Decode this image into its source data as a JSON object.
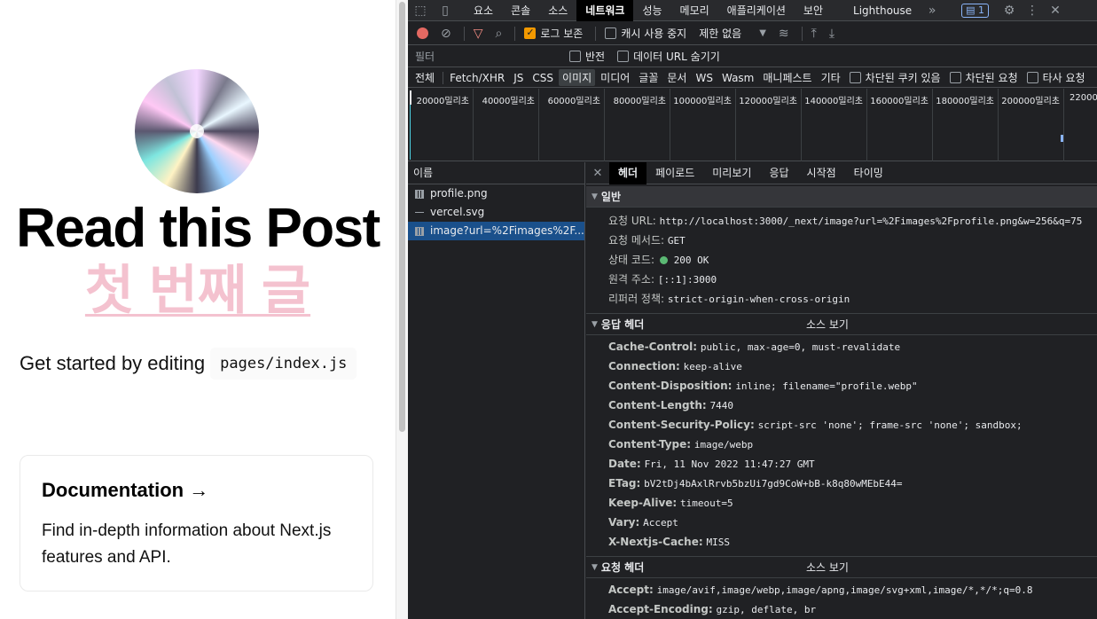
{
  "page": {
    "title": "Read this Post",
    "link": "첫 번째 글",
    "description": "Get started by editing",
    "code": "pages/index.js",
    "card": {
      "title": "Documentation →",
      "text": "Find in-depth information about Next.js features and API."
    }
  },
  "devtools": {
    "tabs": [
      "요소",
      "콘솔",
      "소스",
      "네트워크",
      "성능",
      "메모리",
      "애플리케이션",
      "보안",
      "Lighthouse"
    ],
    "active_tab": "네트워크",
    "more_tabs": "»",
    "issues_badge": "1",
    "toolbar": {
      "preserve_log": "로그 보존",
      "disable_cache": "캐시 사용 중지",
      "throttling": "제한 없음"
    },
    "filter": {
      "placeholder": "필터",
      "invert": "반전",
      "hide_data_urls": "데이터 URL 숨기기"
    },
    "types": [
      "전체",
      "Fetch/XHR",
      "JS",
      "CSS",
      "이미지",
      "미디어",
      "글꼴",
      "문서",
      "WS",
      "Wasm",
      "매니페스트",
      "기타"
    ],
    "active_type": "이미지",
    "type_checks": [
      "차단된 쿠키 있음",
      "차단된 요청",
      "타사 요청"
    ],
    "timeline_ticks": [
      "20000밀리초",
      "40000밀리초",
      "60000밀리초",
      "80000밀리초",
      "100000밀리초",
      "120000밀리초",
      "140000밀리초",
      "160000밀리초",
      "180000밀리초",
      "200000밀리초",
      "22000"
    ],
    "names_header": "이름",
    "requests": [
      "profile.png",
      "vercel.svg",
      "image?url=%2Fimages%2F..."
    ],
    "selected_request": 2,
    "detail_tabs": [
      "헤더",
      "페이로드",
      "미리보기",
      "응답",
      "시작점",
      "타이밍"
    ],
    "active_detail_tab": "헤더",
    "general": {
      "title": "일반",
      "request_url_k": "요청 URL:",
      "request_url_v": "http://localhost:3000/_next/image?url=%2Fimages%2Fprofile.png&w=256&q=75",
      "method_k": "요청 메서드:",
      "method_v": "GET",
      "status_k": "상태 코드:",
      "status_v": "200 OK",
      "remote_k": "원격 주소:",
      "remote_v": "[::1]:3000",
      "referrer_k": "리퍼러 정책:",
      "referrer_v": "strict-origin-when-cross-origin"
    },
    "response_headers": {
      "title": "응답 헤더",
      "view_source": "소스 보기",
      "items": [
        {
          "k": "Cache-Control:",
          "v": "public, max-age=0, must-revalidate"
        },
        {
          "k": "Connection:",
          "v": "keep-alive"
        },
        {
          "k": "Content-Disposition:",
          "v": "inline; filename=\"profile.webp\""
        },
        {
          "k": "Content-Length:",
          "v": "7440"
        },
        {
          "k": "Content-Security-Policy:",
          "v": "script-src 'none'; frame-src 'none'; sandbox;"
        },
        {
          "k": "Content-Type:",
          "v": "image/webp"
        },
        {
          "k": "Date:",
          "v": "Fri, 11 Nov 2022 11:47:27 GMT"
        },
        {
          "k": "ETag:",
          "v": "bV2tDj4bAxlRrvb5bzUi7gd9CoW+bB-k8q80wMEbE44="
        },
        {
          "k": "Keep-Alive:",
          "v": "timeout=5"
        },
        {
          "k": "Vary:",
          "v": "Accept"
        },
        {
          "k": "X-Nextjs-Cache:",
          "v": "MISS"
        }
      ]
    },
    "request_headers": {
      "title": "요청 헤더",
      "view_source": "소스 보기",
      "items": [
        {
          "k": "Accept:",
          "v": "image/avif,image/webp,image/apng,image/svg+xml,image/*,*/*;q=0.8"
        },
        {
          "k": "Accept-Encoding:",
          "v": "gzip, deflate, br"
        }
      ]
    }
  }
}
